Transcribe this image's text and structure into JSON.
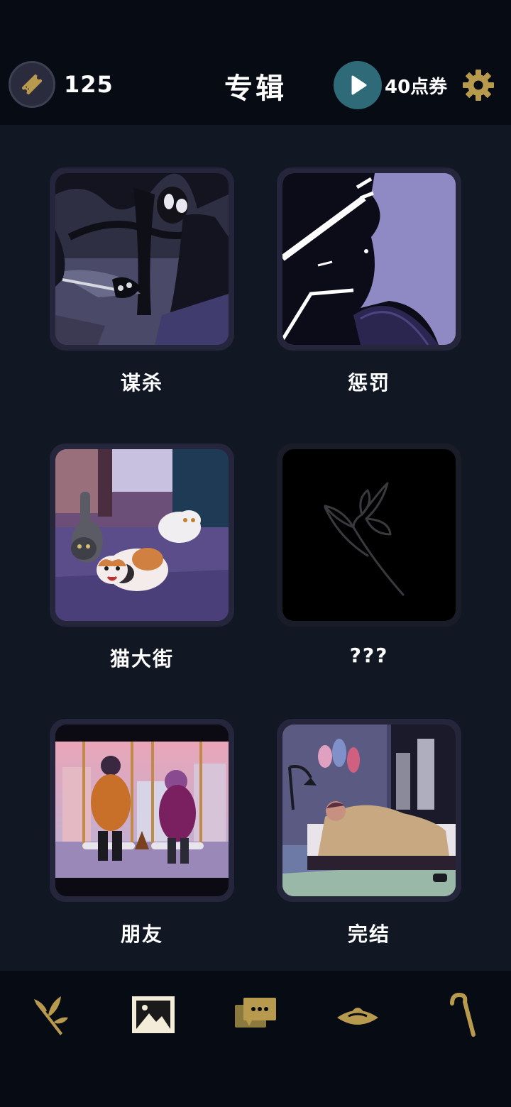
{
  "header": {
    "ticket_count": "125",
    "title": "专辑",
    "voucher_label": "40点券",
    "ticket_icon": "ticket-icon",
    "play_icon": "play-icon",
    "settings_icon": "gear-icon"
  },
  "albums": [
    {
      "label": "谋杀",
      "art": "murder-artwork"
    },
    {
      "label": "惩罚",
      "art": "punishment-artwork"
    },
    {
      "label": "猫大街",
      "art": "cat-street-artwork"
    },
    {
      "label": "???",
      "art": "locked-flower-artwork"
    },
    {
      "label": "朋友",
      "art": "friends-artwork"
    },
    {
      "label": "完结",
      "art": "ending-artwork"
    }
  ],
  "nav": [
    {
      "icon": "branch-icon"
    },
    {
      "icon": "gallery-icon",
      "active": true
    },
    {
      "icon": "chat-icon"
    },
    {
      "icon": "hat-icon"
    },
    {
      "icon": "cane-icon"
    }
  ],
  "colors": {
    "background": "#111723",
    "header_bg": "#070b14",
    "gold_accent": "#b89a4e",
    "play_button": "#2f6a78",
    "frame": "#25253b"
  }
}
